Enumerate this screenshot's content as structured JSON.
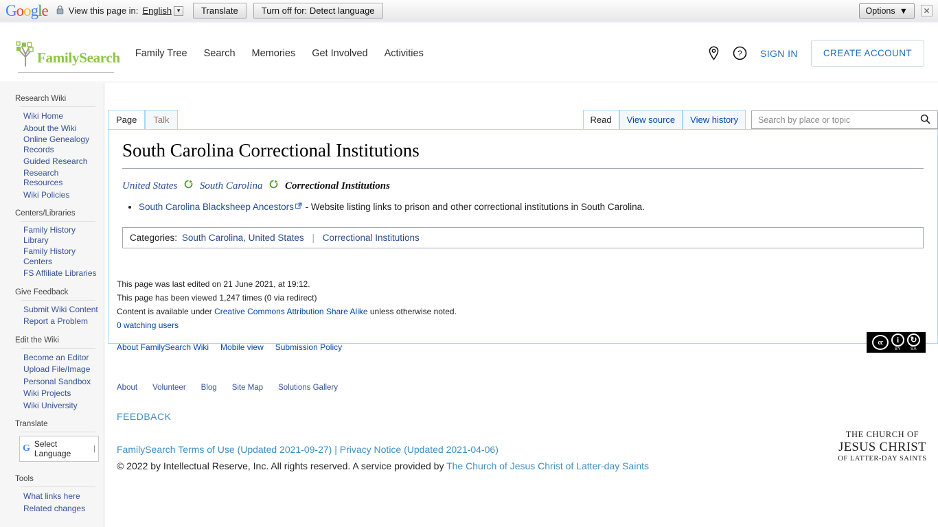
{
  "translate_bar": {
    "logo": "Google",
    "lock_icon": "lock-icon",
    "prompt": "View this page in:",
    "language": "English",
    "translate_button": "Translate",
    "turn_off_button": "Turn off for: Detect language",
    "options_button": "Options",
    "close_icon": "close-icon"
  },
  "header": {
    "brand": "FamilySearch",
    "nav": [
      {
        "label": "Family Tree"
      },
      {
        "label": "Search"
      },
      {
        "label": "Memories"
      },
      {
        "label": "Get Involved"
      },
      {
        "label": "Activities"
      }
    ],
    "location_icon": "location-pin-icon",
    "help_icon": "help-circle-icon",
    "sign_in": "SIGN IN",
    "create_account": "CREATE ACCOUNT"
  },
  "sidebar": {
    "sections": [
      {
        "title": "Research Wiki",
        "items": [
          {
            "label": "Wiki Home"
          },
          {
            "label": "About the Wiki"
          },
          {
            "label": "Online Genealogy Records"
          },
          {
            "label": "Guided Research"
          },
          {
            "label": "Research Resources"
          },
          {
            "label": "Wiki Policies"
          }
        ]
      },
      {
        "title": "Centers/Libraries",
        "items": [
          {
            "label": "Family History Library"
          },
          {
            "label": "Family History Centers"
          },
          {
            "label": "FS Affiliate Libraries"
          }
        ]
      },
      {
        "title": "Give Feedback",
        "items": [
          {
            "label": "Submit Wiki Content"
          },
          {
            "label": "Report a Problem"
          }
        ]
      },
      {
        "title": "Edit the Wiki",
        "items": [
          {
            "label": "Become an Editor"
          },
          {
            "label": "Upload File/Image"
          },
          {
            "label": "Personal Sandbox"
          },
          {
            "label": "Wiki Projects"
          },
          {
            "label": "Wiki University"
          }
        ]
      }
    ],
    "translate_title": "Translate",
    "select_language": "Select Language",
    "tools_title": "Tools",
    "tools_items": [
      {
        "label": "What links here"
      },
      {
        "label": "Related changes"
      }
    ]
  },
  "tabs": {
    "left": [
      {
        "label": "Page",
        "active": true
      },
      {
        "label": "Talk",
        "active": false
      }
    ],
    "right": [
      {
        "label": "Read",
        "active": true
      },
      {
        "label": "View source",
        "active": false
      },
      {
        "label": "View history",
        "active": false
      }
    ],
    "search_placeholder": "Search by place or topic",
    "search_value": "",
    "search_icon": "search-icon"
  },
  "article": {
    "title": "South Carolina Correctional Institutions",
    "breadcrumb": [
      {
        "label": "United States",
        "current": false
      },
      {
        "label": "South Carolina",
        "current": false
      },
      {
        "label": "Correctional Institutions",
        "current": true
      }
    ],
    "bullets": [
      {
        "link": "South Carolina Blacksheep Ancestors",
        "text": " - Website listing links to prison and other correctional institutions in South Carolina."
      }
    ],
    "categories_label": "Categories:",
    "categories": [
      {
        "label": "South Carolina, United States"
      },
      {
        "label": "Correctional Institutions"
      }
    ]
  },
  "page_meta": {
    "last_edited": "This page was last edited on 21 June 2021, at 19:12.",
    "views": "This page has been viewed 1,247 times (0 via redirect)",
    "license_prefix": "Content is available under ",
    "license_link": "Creative Commons Attribution Share Alike",
    "license_suffix": " unless otherwise noted.",
    "watching": "0 watching users",
    "footer_links": [
      {
        "label": "About FamilySearch Wiki"
      },
      {
        "label": "Mobile view"
      },
      {
        "label": "Submission Policy"
      }
    ]
  },
  "cc_badge": {
    "mark": "cc",
    "by_icon": "person-icon",
    "sa_icon": "share-alike-icon",
    "by_caption": "BY",
    "sa_caption": "SA"
  },
  "bottom_nav": [
    {
      "label": "About"
    },
    {
      "label": "Volunteer"
    },
    {
      "label": "Blog"
    },
    {
      "label": "Site Map"
    },
    {
      "label": "Solutions Gallery"
    }
  ],
  "feedback": "FEEDBACK",
  "legal": {
    "terms": "FamilySearch Terms of Use (Updated 2021-09-27)",
    "pipe": "|",
    "privacy": "Privacy Notice (Updated 2021-04-06)",
    "copyright": "© 2022 by Intellectual Reserve, Inc. All rights reserved. A service provided by ",
    "church_link": "The Church of Jesus Christ of Latter-day Saints"
  },
  "church_logo": {
    "line1": "THE CHURCH OF",
    "line2": "JESUS CHRIST",
    "line3": "OF LATTER-DAY SAINTS"
  },
  "colors": {
    "fs_green": "#8CC63E",
    "link_blue": "#2a4b8d",
    "wiki_blue": "#0645ad",
    "tab_border": "#a7d7f9",
    "footer_blue": "#3d8fc4"
  }
}
